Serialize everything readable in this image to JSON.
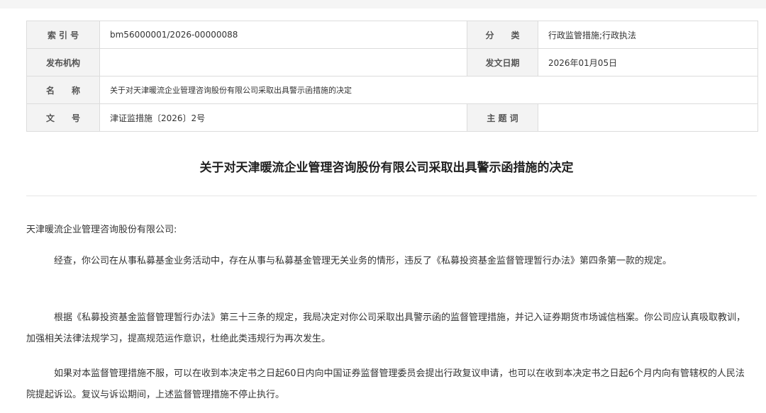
{
  "meta_table": {
    "index_label": "索 引 号",
    "index_value": "bm56000001/2026-00000088",
    "category_label": "分　　类",
    "category_value": "行政监管措施;行政执法",
    "publisher_label": "发布机构",
    "publisher_value": "",
    "date_label": "发文日期",
    "date_value": "2026年01月05日",
    "name_label": "名　　称",
    "name_value": "关于对天津暖流企业管理咨询股份有限公司采取出具警示函措施的决定",
    "docno_label": "文　　号",
    "docno_value": "津证监措施〔2026〕2号",
    "keywords_label": "主 题 词",
    "keywords_value": ""
  },
  "document": {
    "title": "关于对天津暖流企业管理咨询股份有限公司采取出具警示函措施的决定",
    "addressee": "天津暖流企业管理咨询股份有限公司:",
    "paragraphs": [
      "经查，你公司在从事私募基金业务活动中，存在从事与私募基金管理无关业务的情形，违反了《私募投资基金监督管理暂行办法》第四条第一款的规定。",
      "根据《私募投资基金监督管理暂行办法》第三十三条的规定，我局决定对你公司采取出具警示函的监督管理措施，并记入证券期货市场诚信档案。你公司应认真吸取教训，加强相关法律法规学习，提高规范运作意识，杜绝此类违规行为再次发生。",
      "如果对本监督管理措施不服，可以在收到本决定书之日起60日内向中国证券监督管理委员会提出行政复议申请，也可以在收到本决定书之日起6个月内向有管辖权的人民法院提起诉讼。复议与诉讼期间，上述监督管理措施不停止执行。"
    ]
  }
}
